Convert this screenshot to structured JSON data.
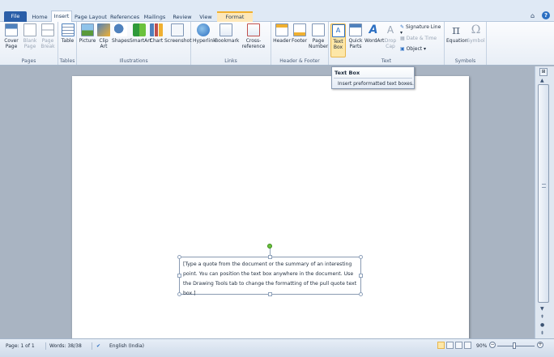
{
  "tabs": [
    {
      "label": "File",
      "kind": "file"
    },
    {
      "label": "Home",
      "kind": "normal"
    },
    {
      "label": "Insert",
      "kind": "active"
    },
    {
      "label": "Page Layout",
      "kind": "normal"
    },
    {
      "label": "References",
      "kind": "normal"
    },
    {
      "label": "Mailings",
      "kind": "normal"
    },
    {
      "label": "Review",
      "kind": "normal"
    },
    {
      "label": "View",
      "kind": "normal"
    },
    {
      "label": "Format",
      "kind": "format"
    }
  ],
  "help": {
    "glyph": "?"
  },
  "ribbon": {
    "pages": {
      "label": "Pages",
      "cover": "Cover Page",
      "blank": "Blank Page",
      "break": "Page Break"
    },
    "tables": {
      "label": "Tables",
      "table": "Table"
    },
    "illustrations": {
      "label": "Illustrations",
      "picture": "Picture",
      "clipart": "Clip Art",
      "shapes": "Shapes",
      "smartart": "SmartArt",
      "chart": "Chart",
      "screenshot": "Screenshot"
    },
    "links": {
      "label": "Links",
      "hyperlink": "Hyperlink",
      "bookmark": "Bookmark",
      "crossref": "Cross-reference"
    },
    "headerfooter": {
      "label": "Header & Footer",
      "header": "Header",
      "footer": "Footer",
      "pagenumber": "Page Number"
    },
    "text": {
      "label": "Text",
      "textbox": "Text Box",
      "quickparts": "Quick Parts",
      "wordart": "WordArt",
      "dropcap": "Drop Cap",
      "signature": "Signature Line",
      "datetime": "Date & Time",
      "object": "Object"
    },
    "symbols": {
      "label": "Symbols",
      "equation": "Equation",
      "symbol": "Symbol",
      "pi": "π",
      "omega": "Ω"
    }
  },
  "tooltip": {
    "title": "Text Box",
    "description": "Insert preformatted text boxes."
  },
  "document": {
    "textbox_text": "[Type a quote from the document or the summary of an interesting point. You can position the text box anywhere in the document. Use the Drawing Tools tab to change the formatting of the pull quote text box.]"
  },
  "status": {
    "page": "Page: 1 of 1",
    "words": "Words: 38/38",
    "language": "English (India)",
    "zoom": "90%",
    "zoom_fraction": 0.45
  },
  "colors": {
    "file_tab": "#2a5ea8",
    "format_tab": "#fde7b9",
    "accent": "#2b6fc2"
  }
}
